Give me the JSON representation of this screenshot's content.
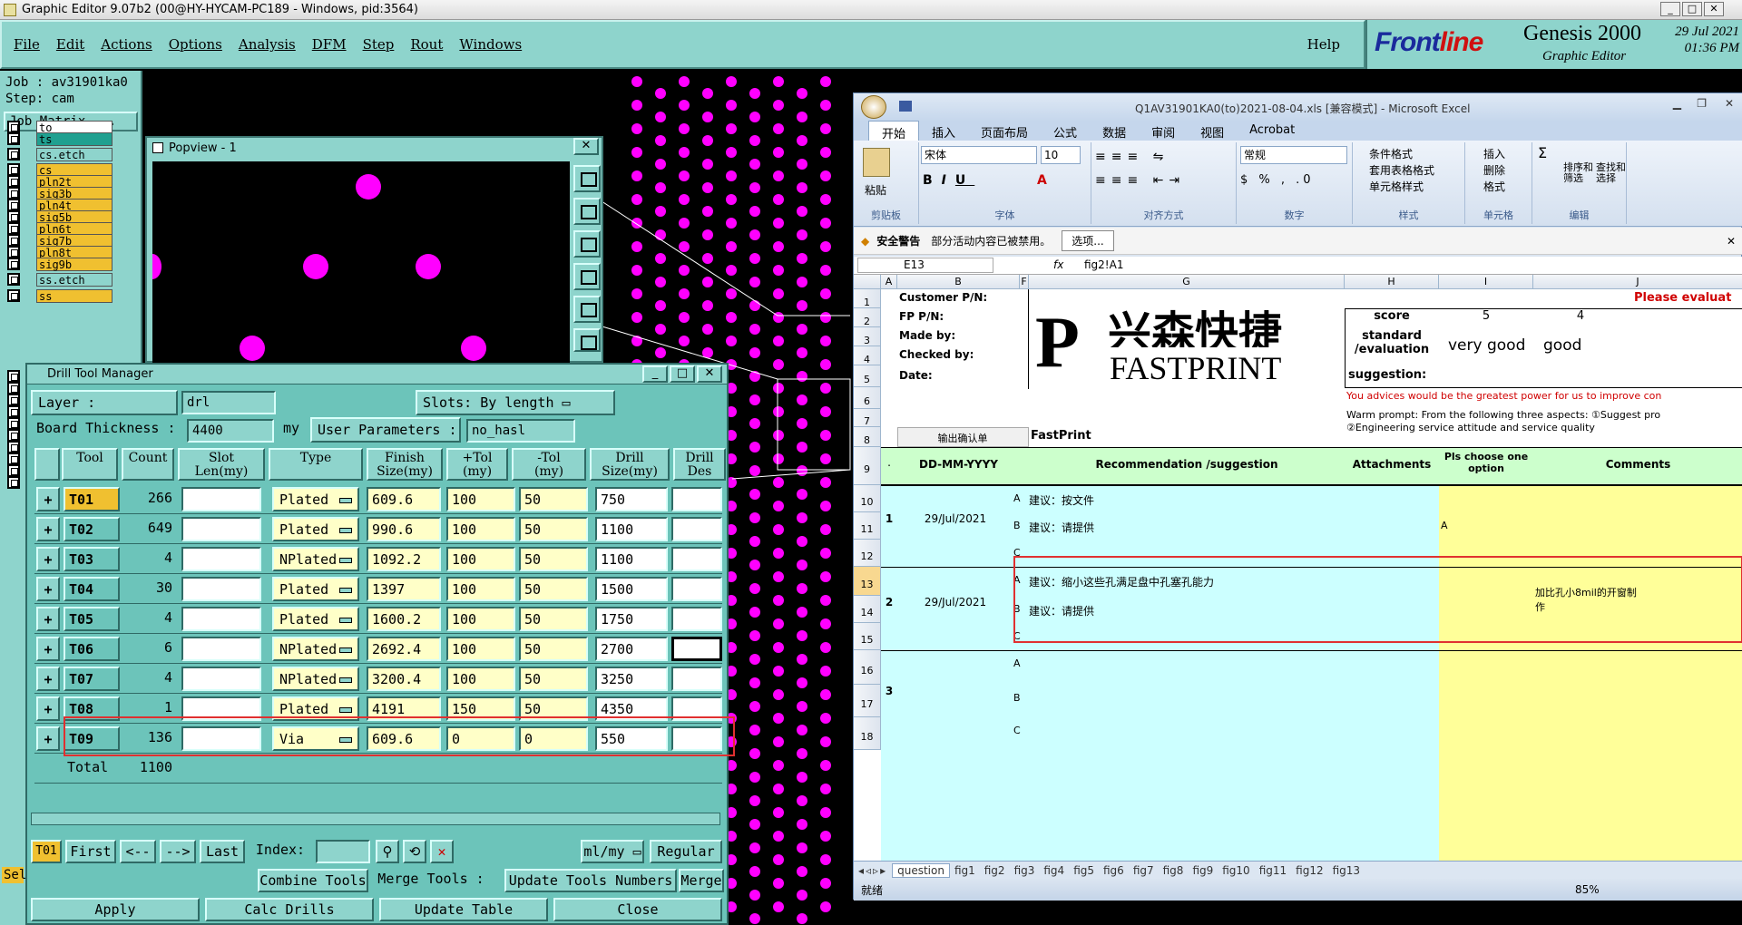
{
  "window_title": "Graphic Editor 9.07b2 (00@HY-HYCAM-PC189 - Windows, pid:3564)",
  "menu": [
    "File",
    "Edit",
    "Actions",
    "Options",
    "Analysis",
    "DFM",
    "Step",
    "Rout",
    "Windows"
  ],
  "help": "Help",
  "brand": {
    "frontline_a": "Front",
    "frontline_b": "line",
    "genesis": "Genesis 2000",
    "graphic_editor": "Graphic Editor",
    "date": "29 Jul 2021",
    "time": "01:36 PM"
  },
  "left": {
    "job": "Job : av31901ka0",
    "step": "Step: cam",
    "job_matrix": "Job Matrix ...",
    "layers": [
      {
        "name": "to",
        "color": "#ffffff"
      },
      {
        "name": "ts",
        "color": "#20a090"
      },
      {
        "name": "cs.etch",
        "color": "#8ed4cc"
      },
      {
        "name": "cs",
        "color": "#f0c030"
      },
      {
        "name": "pln2t",
        "color": "#f0c030"
      },
      {
        "name": "sig3b",
        "color": "#f0c030"
      },
      {
        "name": "pln4t",
        "color": "#f0c030"
      },
      {
        "name": "sig5b",
        "color": "#f0c030"
      },
      {
        "name": "pln6t",
        "color": "#f0c030"
      },
      {
        "name": "sig7b",
        "color": "#f0c030"
      },
      {
        "name": "pln8t",
        "color": "#f0c030"
      },
      {
        "name": "sig9b",
        "color": "#f0c030"
      },
      {
        "name": "ss.etch",
        "color": "#8ed4cc"
      },
      {
        "name": "ss",
        "color": "#f0c030"
      }
    ],
    "sel": "Sel"
  },
  "popview": {
    "title": "Popview - 1"
  },
  "dtm": {
    "title": "Drill Tool Manager",
    "layer_label": "Layer          :",
    "layer_value": "drl",
    "slots_label": "Slots:",
    "slots_value": "By length",
    "thickness_label": "Board Thickness :",
    "thickness_value": "4400",
    "thickness_unit": "my",
    "user_params_label": "User Parameters :",
    "user_params_value": "no_hasl",
    "headers": [
      "Tool",
      "Count",
      "Slot\nLen(my)",
      "Type",
      "Finish\nSize(my)",
      "+Tol\n(my)",
      "-Tol\n(my)",
      "Drill\nSize(my)",
      "Drill\nDes"
    ],
    "rows": [
      {
        "tool": "T01",
        "count": "266",
        "type": "Plated",
        "finish": "609.6",
        "ptol": "100",
        "mtol": "50",
        "drill": "750"
      },
      {
        "tool": "T02",
        "count": "649",
        "type": "Plated",
        "finish": "990.6",
        "ptol": "100",
        "mtol": "50",
        "drill": "1100"
      },
      {
        "tool": "T03",
        "count": "4",
        "type": "NPlated",
        "finish": "1092.2",
        "ptol": "100",
        "mtol": "50",
        "drill": "1100"
      },
      {
        "tool": "T04",
        "count": "30",
        "type": "Plated",
        "finish": "1397",
        "ptol": "100",
        "mtol": "50",
        "drill": "1500"
      },
      {
        "tool": "T05",
        "count": "4",
        "type": "Plated",
        "finish": "1600.2",
        "ptol": "100",
        "mtol": "50",
        "drill": "1750"
      },
      {
        "tool": "T06",
        "count": "6",
        "type": "NPlated",
        "finish": "2692.4",
        "ptol": "100",
        "mtol": "50",
        "drill": "2700"
      },
      {
        "tool": "T07",
        "count": "4",
        "type": "NPlated",
        "finish": "3200.4",
        "ptol": "100",
        "mtol": "50",
        "drill": "3250"
      },
      {
        "tool": "T08",
        "count": "1",
        "type": "Plated",
        "finish": "4191",
        "ptol": "150",
        "mtol": "50",
        "drill": "4350"
      },
      {
        "tool": "T09",
        "count": "136",
        "type": "Via",
        "finish": "609.6",
        "ptol": "0",
        "mtol": "0",
        "drill": "550"
      }
    ],
    "total_label": "Total",
    "total_value": "1100",
    "nav": {
      "current": "T01",
      "first": "First",
      "prev": "<--",
      "next": "-->",
      "last": "Last",
      "index_label": "Index:",
      "units": "ml/my",
      "mode": "Regular"
    },
    "actions1": {
      "combine": "Combine Tools",
      "merge_label": "Merge Tools :",
      "update_numbers": "Update Tools Numbers",
      "merge": "Merge"
    },
    "actions2": {
      "apply": "Apply",
      "calc": "Calc Drills",
      "update_table": "Update Table",
      "close": "Close"
    }
  },
  "excel": {
    "title": "Q1AV31901KA0(to)2021-08-04.xls  [兼容模式]  -  Microsoft Excel",
    "tabs": [
      "开始",
      "插入",
      "页面布局",
      "公式",
      "数据",
      "审阅",
      "视图",
      "Acrobat"
    ],
    "ribbon": {
      "paste": "粘贴",
      "clipboard": "剪贴板",
      "font_name": "宋体",
      "font_size": "10",
      "font_group": "字体",
      "align_group": "对齐方式",
      "num_format": "常规",
      "number_group": "数字",
      "cond_format": "条件格式",
      "table_format": "套用表格格式",
      "cell_style": "单元格样式",
      "style_group": "样式",
      "insert": "插入",
      "delete": "删除",
      "format": "格式",
      "cells_group": "单元格",
      "sort": "排序和\n筛选",
      "find": "查找和\n选择",
      "edit_group": "编辑"
    },
    "warning": {
      "title": "安全警告",
      "text": "部分活动内容已被禁用。",
      "options": "选项..."
    },
    "namebox": "E13",
    "formula": "fig2!A1",
    "cols": [
      "A",
      "B",
      "F",
      "G",
      "H",
      "I",
      "J"
    ],
    "cells": {
      "customer_pn": "Customer P/N:",
      "fp_pn": "FP P/N:",
      "made_by": "Made by:",
      "checked_by": "Checked by:",
      "date": "Date:",
      "logo_cn": "兴森快捷",
      "logo_en": "FASTPRINT",
      "please_eval": "Please evaluat",
      "score": "score",
      "score5": "5",
      "score4": "4",
      "std_eval": "standard\n/evaluation",
      "very_good": "very good",
      "good": "good",
      "suggestion": "suggestion:",
      "advice": "You advices would be the greatest power for us to improve con",
      "warm1": "Warm prompt:  From the following three aspects: ①Suggest pro",
      "warm2": "②Engineering service attitude and service quality",
      "output_confirm": "输出确认单",
      "fastprint": "FastPrint",
      "h_dot": ".",
      "h_date": "DD-MM-YYYY",
      "h_rec": "Recommendation /suggestion",
      "h_att": "Attachments",
      "h_opt": "Pls choose one\noption",
      "h_comments": "Comments",
      "n1": "1",
      "d1": "29/Jul/2021",
      "r10": "建议：按文件",
      "r11": "建议：请提供",
      "i11": "A",
      "n2": "2",
      "d2": "29/Jul/2021",
      "r13": "建议：缩小这些孔满足盘中孔塞孔能力",
      "r14": "建议：请提供",
      "j13": "加比孔小8mil的开窗制\n作",
      "n3": "3"
    },
    "rows": [
      "1",
      "2",
      "3",
      "4",
      "5",
      "6",
      "7",
      "8",
      "9",
      "10",
      "11",
      "12",
      "13",
      "14",
      "15",
      "16",
      "17",
      "18"
    ],
    "sheet_tabs": [
      "question",
      "fig1",
      "fig2",
      "fig3",
      "fig4",
      "fig5",
      "fig6",
      "fig7",
      "fig8",
      "fig9",
      "fig10",
      "fig11",
      "fig12",
      "fig13"
    ],
    "status": "就绪",
    "zoom": "85%"
  },
  "colors": {
    "teal": "#8ed4cc",
    "magenta": "#ff00ff",
    "highlight": "#e03030"
  }
}
